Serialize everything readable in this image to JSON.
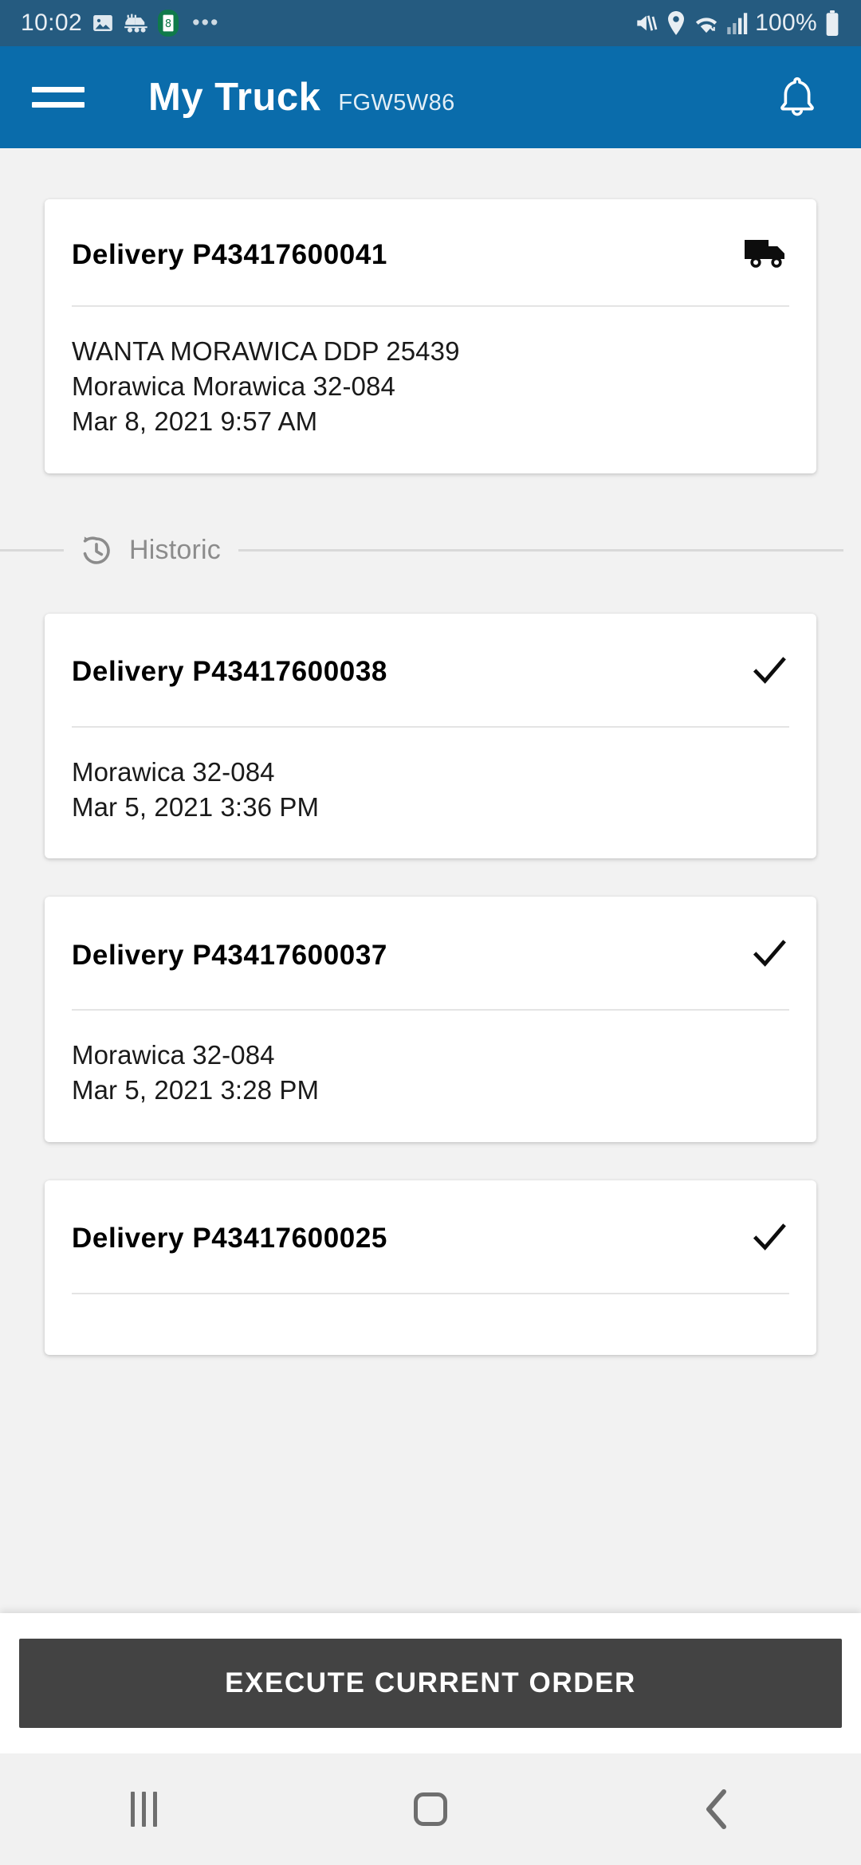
{
  "status_bar": {
    "time": "10:02",
    "battery_percent": "100%",
    "icons": [
      "image-icon",
      "truck-icon",
      "calendar-icon",
      "overflow-dots-icon",
      "mute-vibrate-icon",
      "location-pin-icon",
      "wifi-icon",
      "signal-bars-icon",
      "battery-icon"
    ],
    "overflow": "•••",
    "background_color": "#255b80"
  },
  "app_bar": {
    "title": "My Truck",
    "plate": "FGW5W86",
    "menu_icon": "hamburger-menu-icon",
    "notification_icon": "bell-icon",
    "background_color": "#0a6cab"
  },
  "current_delivery": {
    "title": "Delivery P43417600041",
    "status_icon": "truck-icon",
    "lines": [
      "WANTA MORAWICA DDP 25439",
      "Morawica Morawica 32-084",
      "Mar 8, 2021 9:57 AM"
    ]
  },
  "historic_section": {
    "label": "Historic",
    "icon": "history-clock-icon"
  },
  "historic_deliveries": [
    {
      "title": "Delivery P43417600038",
      "status_icon": "check-icon",
      "lines": [
        "Morawica 32-084",
        "Mar 5, 2021 3:36 PM"
      ]
    },
    {
      "title": "Delivery P43417600037",
      "status_icon": "check-icon",
      "lines": [
        "Morawica 32-084",
        "Mar 5, 2021 3:28 PM"
      ]
    },
    {
      "title": "Delivery P43417600025",
      "status_icon": "check-icon",
      "lines": []
    }
  ],
  "bottom_action": {
    "label": "EXECUTE CURRENT ORDER",
    "background_color": "#434343"
  },
  "nav_bar": {
    "recents_icon": "recents-icon",
    "home_icon": "home-icon",
    "back_icon": "back-chevron-icon",
    "background_color": "#f1f1f1"
  }
}
